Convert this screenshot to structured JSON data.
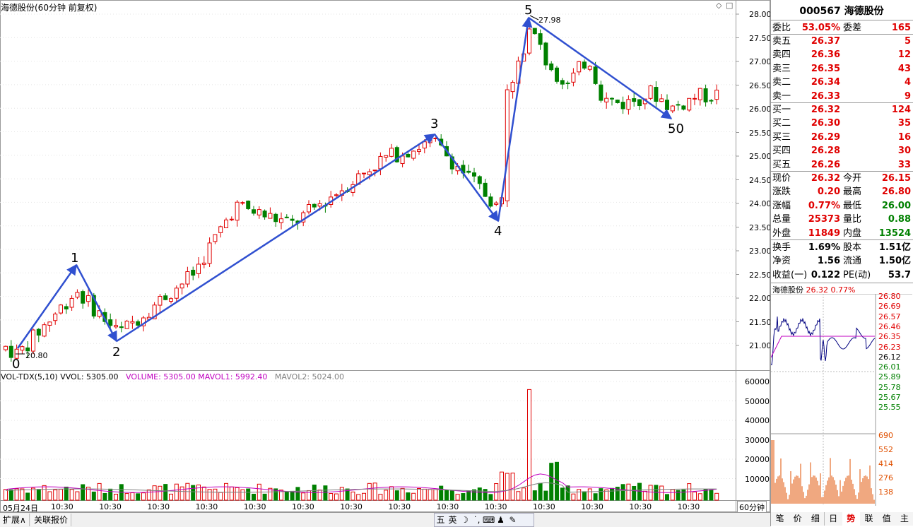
{
  "chart_title": "海德股份(60分钟 前复权)",
  "top_icons": [
    "◇",
    "□"
  ],
  "wave_labels": [
    "0",
    "1",
    "2",
    "3",
    "4",
    "5",
    "50"
  ],
  "price_marks": {
    "low": "20.80",
    "high": "27.98"
  },
  "price_axis": [
    "28.00",
    "27.50",
    "27.00",
    "26.50",
    "26.00",
    "25.50",
    "25.00",
    "24.50",
    "24.00",
    "23.50",
    "23.00",
    "22.50",
    "22.00",
    "21.50",
    "21.00"
  ],
  "volume_header": {
    "name": "VOL-TDX(5,10)",
    "vvol": "VVOL: 5305.00",
    "volume": "VOLUME: 5305.00",
    "mavol1": "MAVOL1: 5992.40",
    "mavol2": "MAVOL2: 5024.00"
  },
  "volume_axis": [
    "60000",
    "50000",
    "40000",
    "30000",
    "20000",
    "10000"
  ],
  "time_axis": [
    "05月24日",
    "10:30",
    "10:30",
    "10:30",
    "10:30",
    "10:30",
    "10:30",
    "10:30",
    "10:30",
    "10:30",
    "10:30",
    "10:30",
    "10:30",
    "10:30",
    "10:30"
  ],
  "period": "60分钟",
  "bottom_tabs": [
    "扩展∧",
    "关联报价"
  ],
  "ime_toolbar": [
    "五",
    "英",
    "☽",
    "˙,",
    "⌨",
    "♟",
    "✎"
  ],
  "colors": {
    "up": "#e00000",
    "down": "#008000",
    "wave": "#3050d0",
    "ma1": "#c000c0",
    "ma2": "#808080"
  },
  "stock": {
    "code": "000567",
    "name": "海德股份"
  },
  "weibi": {
    "label": "委比",
    "value": "53.05%",
    "label2": "委差",
    "value2": "165"
  },
  "asks": [
    {
      "label": "卖五",
      "price": "26.37",
      "vol": "5"
    },
    {
      "label": "卖四",
      "price": "26.36",
      "vol": "12"
    },
    {
      "label": "卖三",
      "price": "26.35",
      "vol": "43"
    },
    {
      "label": "卖二",
      "price": "26.34",
      "vol": "4"
    },
    {
      "label": "卖一",
      "price": "26.33",
      "vol": "9"
    }
  ],
  "bids": [
    {
      "label": "买一",
      "price": "26.32",
      "vol": "124"
    },
    {
      "label": "买二",
      "price": "26.30",
      "vol": "35"
    },
    {
      "label": "买三",
      "price": "26.29",
      "vol": "16"
    },
    {
      "label": "买四",
      "price": "26.28",
      "vol": "30"
    },
    {
      "label": "买五",
      "price": "26.26",
      "vol": "33"
    }
  ],
  "quote": [
    {
      "l1": "现价",
      "v1": "26.32",
      "c1": "red",
      "l2": "今开",
      "v2": "26.15",
      "c2": "red"
    },
    {
      "l1": "涨跌",
      "v1": "0.20",
      "c1": "red",
      "l2": "最高",
      "v2": "26.80",
      "c2": "red"
    },
    {
      "l1": "涨幅",
      "v1": "0.77%",
      "c1": "red",
      "l2": "最低",
      "v2": "26.00",
      "c2": "grn"
    },
    {
      "l1": "总量",
      "v1": "25373",
      "c1": "red",
      "l2": "量比",
      "v2": "0.88",
      "c2": "grn"
    },
    {
      "l1": "外盘",
      "v1": "11849",
      "c1": "red",
      "l2": "内盘",
      "v2": "13524",
      "c2": "grn"
    }
  ],
  "fundamentals": [
    {
      "l1": "换手",
      "v1": "1.69%",
      "l2": "股本",
      "v2": "1.51亿"
    },
    {
      "l1": "净资",
      "v1": "1.56",
      "l2": "流通",
      "v2": "1.50亿"
    },
    {
      "l1": "收益(一)",
      "v1": "0.122",
      "l2": "PE(动)",
      "v2": "53.7"
    }
  ],
  "mini": {
    "title": "海德股份",
    "price": "26.32",
    "pct": "0.77%",
    "axis": [
      "26.80",
      "26.69",
      "26.57",
      "26.46",
      "26.35",
      "26.23",
      "26.12",
      "26.01",
      "25.89",
      "25.78",
      "25.67",
      "25.55"
    ],
    "vol_axis": [
      "690",
      "552",
      "414",
      "276",
      "138"
    ]
  },
  "side_tabs": [
    "笔",
    "价",
    "细",
    "日",
    "势",
    "联",
    "值",
    "主"
  ],
  "active_side_tab": "势"
}
